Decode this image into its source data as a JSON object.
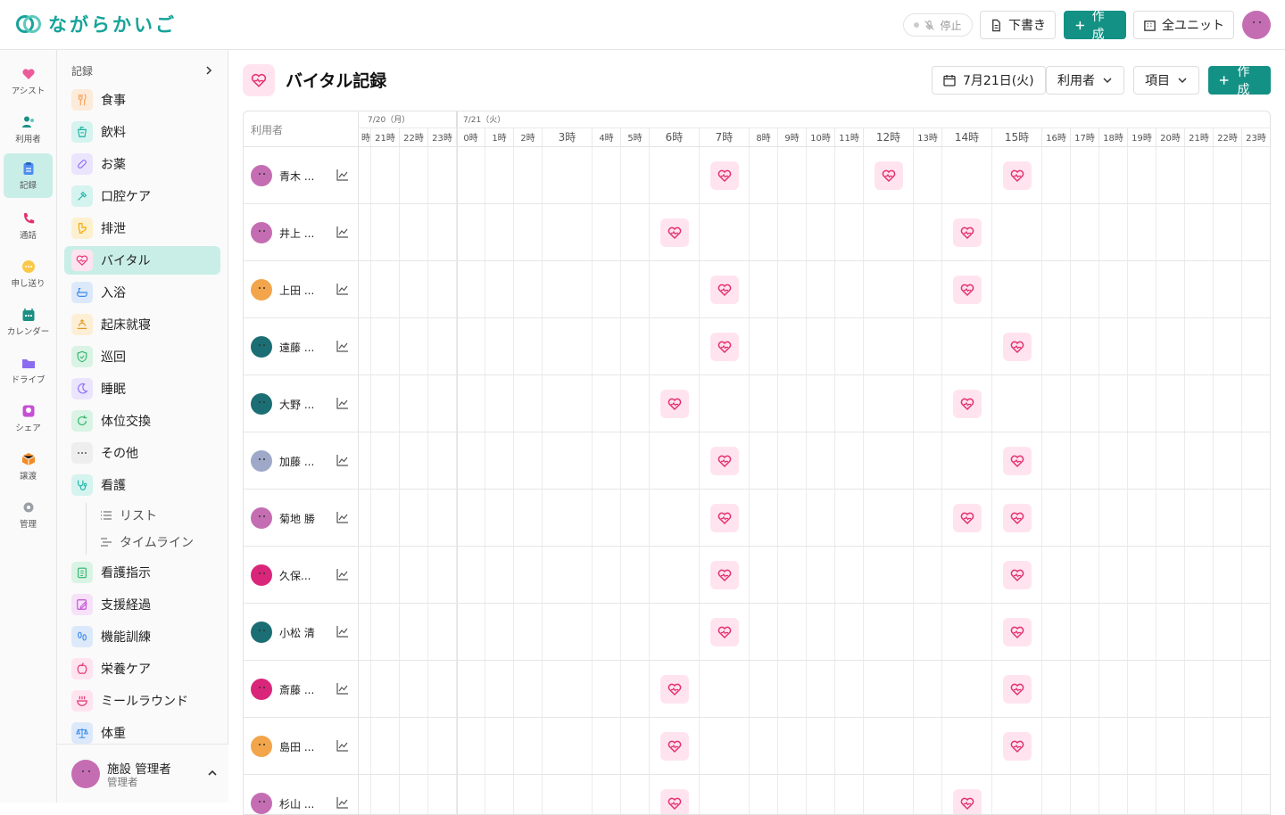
{
  "brand": {
    "name": "ながらかいご"
  },
  "topbar": {
    "stop_label": "停止",
    "draft_label": "下書き",
    "create_label": "作成",
    "units_label": "全ユニット"
  },
  "rail": [
    {
      "label": "アシスト",
      "icon": "heart-icon"
    },
    {
      "label": "利用者",
      "icon": "people-icon"
    },
    {
      "label": "記録",
      "icon": "clipboard-icon"
    },
    {
      "label": "通話",
      "icon": "phone-icon"
    },
    {
      "label": "申し送り",
      "icon": "chat-bubble-icon"
    },
    {
      "label": "カレンダー",
      "icon": "calendar-icon"
    },
    {
      "label": "ドライブ",
      "icon": "folder-icon"
    },
    {
      "label": "シェア",
      "icon": "image-icon"
    },
    {
      "label": "譲渡",
      "icon": "box-icon"
    },
    {
      "label": "管理",
      "icon": "gear-icon"
    }
  ],
  "menu": {
    "title": "記録",
    "items": [
      {
        "label": "食事",
        "icon": "fork-knife-icon",
        "color": "#f6a15a",
        "bg": "#fdebd9"
      },
      {
        "label": "飲料",
        "icon": "cup-icon",
        "color": "#1bb3a6",
        "bg": "#d5f3ef"
      },
      {
        "label": "お薬",
        "icon": "pill-icon",
        "color": "#8b6cf0",
        "bg": "#ebe4fd"
      },
      {
        "label": "口腔ケア",
        "icon": "toothbrush-icon",
        "color": "#1bb3a6",
        "bg": "#d5f3ef"
      },
      {
        "label": "排泄",
        "icon": "toilet-icon",
        "color": "#f2a900",
        "bg": "#fdf0cf"
      },
      {
        "label": "バイタル",
        "icon": "heartbeat-icon",
        "color": "#e3306f",
        "bg": "#ffe4ef"
      },
      {
        "label": "入浴",
        "icon": "bathtub-icon",
        "color": "#3b8be8",
        "bg": "#dce9fb"
      },
      {
        "label": "起床就寝",
        "icon": "sunrise-icon",
        "color": "#e39a22",
        "bg": "#fdefd6"
      },
      {
        "label": "巡回",
        "icon": "shield-icon",
        "color": "#2fb36b",
        "bg": "#d9f3e4"
      },
      {
        "label": "睡眠",
        "icon": "moon-icon",
        "color": "#8b6cf0",
        "bg": "#ebe4fd"
      },
      {
        "label": "体位交換",
        "icon": "rotate-icon",
        "color": "#2fb36b",
        "bg": "#d9f3e4"
      },
      {
        "label": "その他",
        "icon": "dots-icon",
        "color": "#555555",
        "bg": "#eeeeee"
      },
      {
        "label": "看護",
        "icon": "stethoscope-icon",
        "color": "#1bb3a6",
        "bg": "#d5f3ef"
      }
    ],
    "sub_items": [
      {
        "label": "リスト",
        "icon": "list-icon"
      },
      {
        "label": "タイムライン",
        "icon": "timeline-icon"
      }
    ],
    "items_after": [
      {
        "label": "看護指示",
        "icon": "clipboard-list-icon",
        "color": "#2fb36b",
        "bg": "#d9f3e4"
      },
      {
        "label": "支援経過",
        "icon": "edit-note-icon",
        "color": "#c64fd6",
        "bg": "#f6e1f9"
      },
      {
        "label": "機能訓練",
        "icon": "footprints-icon",
        "color": "#3b8be8",
        "bg": "#dce9fb"
      },
      {
        "label": "栄養ケア",
        "icon": "apple-icon",
        "color": "#e3306f",
        "bg": "#ffe4ef"
      },
      {
        "label": "ミールラウンド",
        "icon": "bowl-icon",
        "color": "#e3306f",
        "bg": "#ffe4ef"
      },
      {
        "label": "体重",
        "icon": "scale-icon",
        "color": "#3b8be8",
        "bg": "#dce9fb"
      }
    ]
  },
  "current_user": {
    "name": "施設 管理者",
    "role": "管理者"
  },
  "page": {
    "title": "バイタル記録",
    "date": "7月21日(火)",
    "user_filter": "利用者",
    "item_filter": "項目",
    "create": "作成"
  },
  "grid": {
    "user_col": "利用者",
    "day1_label": "7/20（月）",
    "day2_label": "7/21（火）",
    "day1_hours": [
      "時",
      "21時",
      "22時",
      "23時"
    ],
    "day2_hours": [
      "0時",
      "1時",
      "2時",
      "3時",
      "4時",
      "5時",
      "6時",
      "7時",
      "8時",
      "9時",
      "10時",
      "11時",
      "12時",
      "13時",
      "14時",
      "15時",
      "16時",
      "17時",
      "18時",
      "19時",
      "20時",
      "21時",
      "22時",
      "23時"
    ],
    "wide_hours": [
      "3時",
      "6時",
      "7時",
      "12時",
      "14時",
      "15時"
    ],
    "residents": [
      {
        "name": "青木 ...",
        "avatar": "#c56db2",
        "vitals": [
          "7時",
          "12時",
          "15時"
        ]
      },
      {
        "name": "井上 ...",
        "avatar": "#c56db2",
        "vitals": [
          "6時",
          "14時"
        ]
      },
      {
        "name": "上田 ...",
        "avatar": "#f2a54a",
        "vitals": [
          "7時",
          "14時"
        ]
      },
      {
        "name": "遠藤 ...",
        "avatar": "#1b6e74",
        "vitals": [
          "7時",
          "15時"
        ]
      },
      {
        "name": "大野 ...",
        "avatar": "#1b6e74",
        "vitals": [
          "6時",
          "14時"
        ]
      },
      {
        "name": "加藤 ...",
        "avatar": "#9ea9c9",
        "vitals": [
          "7時",
          "15時"
        ]
      },
      {
        "name": "菊地 勝",
        "avatar": "#c56db2",
        "vitals": [
          "7時",
          "14時",
          "15時"
        ]
      },
      {
        "name": "久保...",
        "avatar": "#d9267a",
        "vitals": [
          "7時",
          "15時"
        ]
      },
      {
        "name": "小松 清",
        "avatar": "#1b6e74",
        "vitals": [
          "7時",
          "15時"
        ]
      },
      {
        "name": "斎藤 ...",
        "avatar": "#d9267a",
        "vitals": [
          "6時",
          "15時"
        ]
      },
      {
        "name": "島田 ...",
        "avatar": "#f2a54a",
        "vitals": [
          "6時",
          "15時"
        ]
      },
      {
        "name": "杉山 ...",
        "avatar": "#c56db2",
        "vitals": [
          "6時",
          "14時"
        ]
      }
    ]
  }
}
